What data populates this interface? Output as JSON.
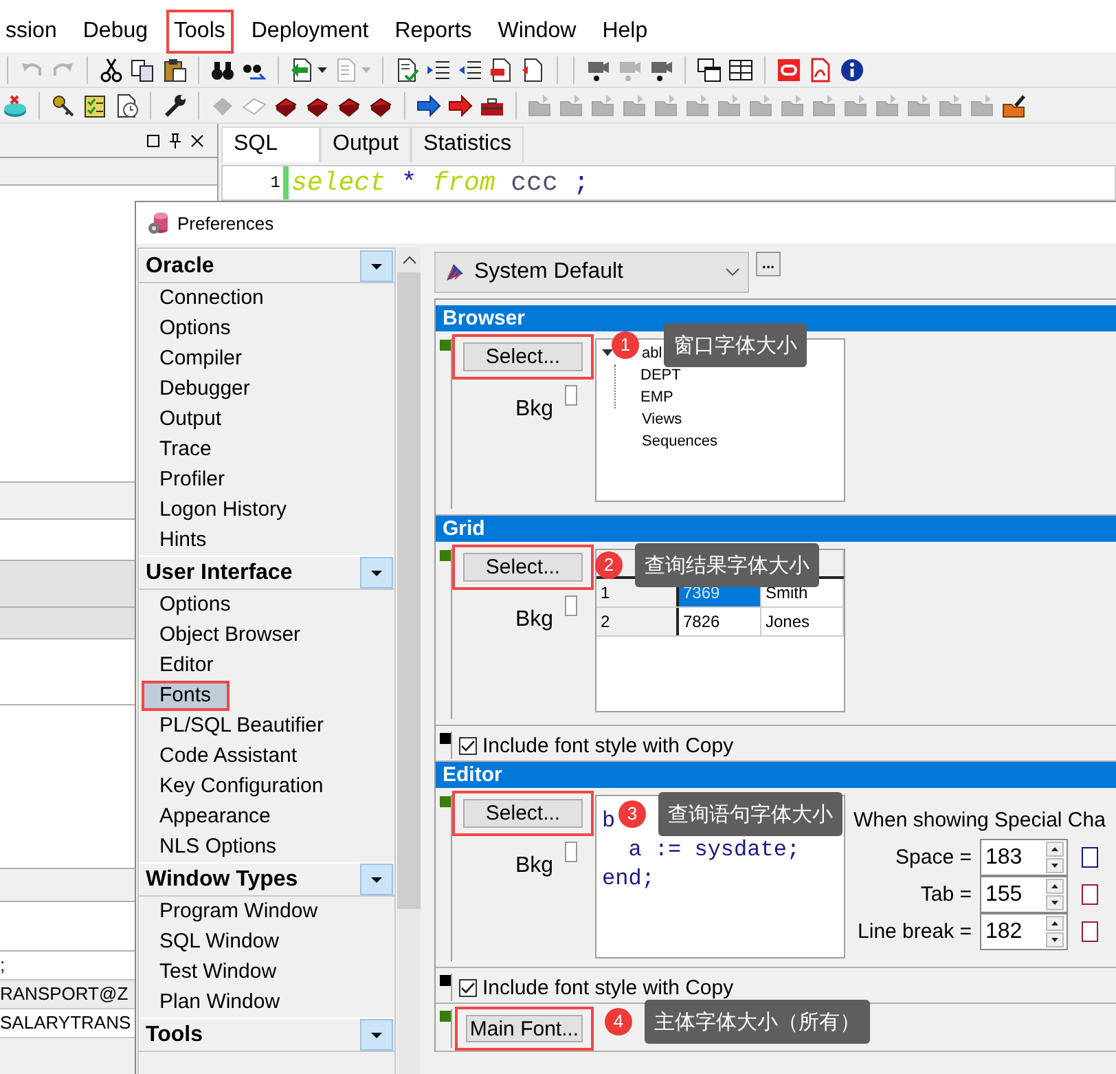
{
  "menu": [
    {
      "label": "ssion",
      "highlighted": false
    },
    {
      "label": "Debug",
      "highlighted": false
    },
    {
      "label": "Tools",
      "highlighted": true
    },
    {
      "label": "Deployment",
      "highlighted": false
    },
    {
      "label": "Reports",
      "highlighted": false
    },
    {
      "label": "Window",
      "highlighted": false
    },
    {
      "label": "Help",
      "highlighted": false
    }
  ],
  "side_panel": {
    "lines": [
      ";",
      "RANSPORT@Z",
      "SALARYTRANS"
    ]
  },
  "editor_tabs": [
    {
      "label": "SQL",
      "selected": true
    },
    {
      "label": "Output",
      "selected": false
    },
    {
      "label": "Statistics",
      "selected": false
    }
  ],
  "editor": {
    "line_number": "1",
    "tokens": [
      {
        "text": "select",
        "kind": "keyword"
      },
      {
        "text": "*",
        "kind": "operator"
      },
      {
        "text": "from",
        "kind": "keyword"
      },
      {
        "text": "ccc",
        "kind": "identifier"
      },
      {
        "text": ";",
        "kind": "operator"
      }
    ]
  },
  "dialog": {
    "title": "Preferences",
    "groups": [
      {
        "label": "Oracle",
        "items": [
          {
            "label": "Connection",
            "selected": false,
            "highlighted": false
          },
          {
            "label": "Options",
            "selected": false,
            "highlighted": false
          },
          {
            "label": "Compiler",
            "selected": false,
            "highlighted": false
          },
          {
            "label": "Debugger",
            "selected": false,
            "highlighted": false
          },
          {
            "label": "Output",
            "selected": false,
            "highlighted": false
          },
          {
            "label": "Trace",
            "selected": false,
            "highlighted": false
          },
          {
            "label": "Profiler",
            "selected": false,
            "highlighted": false
          },
          {
            "label": "Logon History",
            "selected": false,
            "highlighted": false
          },
          {
            "label": "Hints",
            "selected": false,
            "highlighted": false
          }
        ]
      },
      {
        "label": "User Interface",
        "items": [
          {
            "label": "Options",
            "selected": false,
            "highlighted": false
          },
          {
            "label": "Object Browser",
            "selected": false,
            "highlighted": false
          },
          {
            "label": "Editor",
            "selected": false,
            "highlighted": false
          },
          {
            "label": "Fonts",
            "selected": true,
            "highlighted": true
          },
          {
            "label": "PL/SQL Beautifier",
            "selected": false,
            "highlighted": false
          },
          {
            "label": "Code Assistant",
            "selected": false,
            "highlighted": false
          },
          {
            "label": "Key Configuration",
            "selected": false,
            "highlighted": false
          },
          {
            "label": "Appearance",
            "selected": false,
            "highlighted": false
          },
          {
            "label": "NLS Options",
            "selected": false,
            "highlighted": false
          }
        ]
      },
      {
        "label": "Window Types",
        "items": [
          {
            "label": "Program Window",
            "selected": false,
            "highlighted": false
          },
          {
            "label": "SQL Window",
            "selected": false,
            "highlighted": false
          },
          {
            "label": "Test Window",
            "selected": false,
            "highlighted": false
          },
          {
            "label": "Plan Window",
            "selected": false,
            "highlighted": false
          }
        ]
      },
      {
        "label": "Tools"
      }
    ],
    "font_set": "System Default",
    "more_button": "...",
    "sections": [
      {
        "kind": "font",
        "title": "Browser",
        "button": "Select...",
        "highlighted": true,
        "bkg_label": "Bkg",
        "bkg_checked": false,
        "preview": {
          "kind": "tree",
          "nodes": [
            {
              "label": "abl",
              "children": [
                {
                  "label": "DEPT"
                },
                {
                  "label": "EMP"
                }
              ]
            },
            {
              "label": "Views"
            },
            {
              "label": "Sequences"
            }
          ]
        },
        "callout": {
          "number": "1",
          "text": "窗口字体大小"
        }
      },
      {
        "kind": "font",
        "title": "Grid",
        "button": "Select...",
        "highlighted": true,
        "bkg_label": "Bkg",
        "bkg_checked": false,
        "preview": {
          "kind": "grid",
          "rows": [
            {
              "cells": [
                {
                  "text": "1",
                  "selected": false
                },
                {
                  "text": "7369",
                  "selected": true
                },
                {
                  "text": "Smith",
                  "selected": false
                }
              ]
            },
            {
              "cells": [
                {
                  "text": "2",
                  "selected": false
                },
                {
                  "text": "7826",
                  "selected": false
                },
                {
                  "text": "Jones",
                  "selected": false
                }
              ]
            }
          ]
        },
        "callout": {
          "number": "2",
          "text": "查询结果字体大小"
        }
      },
      {
        "kind": "checkbox",
        "label": "Include font style with Copy",
        "checked": true
      },
      {
        "kind": "font",
        "title": "Editor",
        "button": "Select...",
        "highlighted": true,
        "bkg_label": "Bkg",
        "bkg_checked": false,
        "preview": {
          "kind": "code",
          "lines": [
            "b",
            "  a := sysdate;",
            "end;"
          ]
        },
        "callout": {
          "number": "3",
          "text": "查询语句字体大小"
        },
        "special": {
          "heading": "When showing Special Cha",
          "rows": [
            {
              "label": "Space =",
              "value": "183",
              "checked": false
            },
            {
              "label": "Tab =",
              "value": "155",
              "checked": false
            },
            {
              "label": "Line break =",
              "value": "182",
              "checked": false
            }
          ]
        }
      },
      {
        "kind": "checkbox",
        "label": "Include font style with Copy",
        "checked": true
      },
      {
        "kind": "main",
        "button": "Main Font...",
        "highlighted": true,
        "callout": {
          "number": "4",
          "text": "主体字体大小（所有）"
        }
      }
    ]
  }
}
